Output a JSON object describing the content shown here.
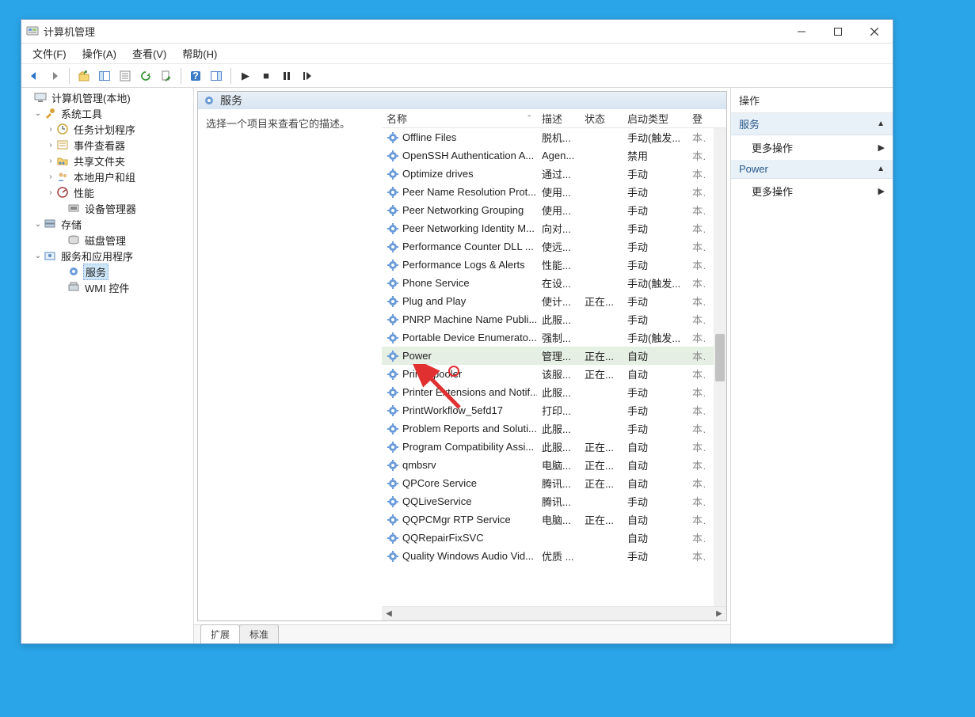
{
  "window": {
    "title": "计算机管理"
  },
  "menu": {
    "file": "文件(F)",
    "action": "操作(A)",
    "view": "查看(V)",
    "help": "帮助(H)"
  },
  "tree": {
    "root": "计算机管理(本地)",
    "system_tools": "系统工具",
    "task_scheduler": "任务计划程序",
    "event_viewer": "事件查看器",
    "shared_folders": "共享文件夹",
    "local_users": "本地用户和组",
    "performance": "性能",
    "device_manager": "设备管理器",
    "storage": "存储",
    "disk_mgmt": "磁盘管理",
    "services_apps": "服务和应用程序",
    "services": "服务",
    "wmi": "WMI 控件"
  },
  "center": {
    "header": "服务",
    "description": "选择一个项目来查看它的描述。",
    "columns": {
      "name": "名称",
      "desc": "描述",
      "status": "状态",
      "startup": "启动类型",
      "logon": "登"
    },
    "rows": [
      {
        "name": "Offline Files",
        "desc": "脱机...",
        "status": "",
        "startup": "手动(触发...",
        "logon": "本"
      },
      {
        "name": "OpenSSH Authentication A...",
        "desc": "Agen...",
        "status": "",
        "startup": "禁用",
        "logon": "本"
      },
      {
        "name": "Optimize drives",
        "desc": "通过...",
        "status": "",
        "startup": "手动",
        "logon": "本"
      },
      {
        "name": "Peer Name Resolution Prot...",
        "desc": "使用...",
        "status": "",
        "startup": "手动",
        "logon": "本"
      },
      {
        "name": "Peer Networking Grouping",
        "desc": "使用...",
        "status": "",
        "startup": "手动",
        "logon": "本"
      },
      {
        "name": "Peer Networking Identity M...",
        "desc": "向对...",
        "status": "",
        "startup": "手动",
        "logon": "本"
      },
      {
        "name": "Performance Counter DLL ...",
        "desc": "使远...",
        "status": "",
        "startup": "手动",
        "logon": "本"
      },
      {
        "name": "Performance Logs & Alerts",
        "desc": "性能...",
        "status": "",
        "startup": "手动",
        "logon": "本"
      },
      {
        "name": "Phone Service",
        "desc": "在设...",
        "status": "",
        "startup": "手动(触发...",
        "logon": "本"
      },
      {
        "name": "Plug and Play",
        "desc": "使计...",
        "status": "正在...",
        "startup": "手动",
        "logon": "本"
      },
      {
        "name": "PNRP Machine Name Publi...",
        "desc": "此服...",
        "status": "",
        "startup": "手动",
        "logon": "本"
      },
      {
        "name": "Portable Device Enumerato...",
        "desc": "强制...",
        "status": "",
        "startup": "手动(触发...",
        "logon": "本"
      },
      {
        "name": "Power",
        "desc": "管理...",
        "status": "正在...",
        "startup": "自动",
        "logon": "本",
        "selected": true
      },
      {
        "name": "Print Spooler",
        "desc": "该服...",
        "status": "正在...",
        "startup": "自动",
        "logon": "本"
      },
      {
        "name": "Printer Extensions and Notif...",
        "desc": "此服...",
        "status": "",
        "startup": "手动",
        "logon": "本"
      },
      {
        "name": "PrintWorkflow_5efd17",
        "desc": "打印...",
        "status": "",
        "startup": "手动",
        "logon": "本"
      },
      {
        "name": "Problem Reports and Soluti...",
        "desc": "此服...",
        "status": "",
        "startup": "手动",
        "logon": "本"
      },
      {
        "name": "Program Compatibility Assi...",
        "desc": "此服...",
        "status": "正在...",
        "startup": "自动",
        "logon": "本"
      },
      {
        "name": "qmbsrv",
        "desc": "电脑...",
        "status": "正在...",
        "startup": "自动",
        "logon": "本"
      },
      {
        "name": "QPCore Service",
        "desc": "腾讯...",
        "status": "正在...",
        "startup": "自动",
        "logon": "本"
      },
      {
        "name": "QQLiveService",
        "desc": "腾讯...",
        "status": "",
        "startup": "手动",
        "logon": "本"
      },
      {
        "name": "QQPCMgr RTP Service",
        "desc": "电脑...",
        "status": "正在...",
        "startup": "自动",
        "logon": "本"
      },
      {
        "name": "QQRepairFixSVC",
        "desc": "",
        "status": "",
        "startup": "自动",
        "logon": "本"
      },
      {
        "name": "Quality Windows Audio Vid...",
        "desc": "优质 ...",
        "status": "",
        "startup": "手动",
        "logon": "本"
      }
    ]
  },
  "tabs": {
    "extended": "扩展",
    "standard": "标准"
  },
  "actions": {
    "title": "操作",
    "sect1": "服务",
    "more": "更多操作",
    "sect2": "Power"
  }
}
